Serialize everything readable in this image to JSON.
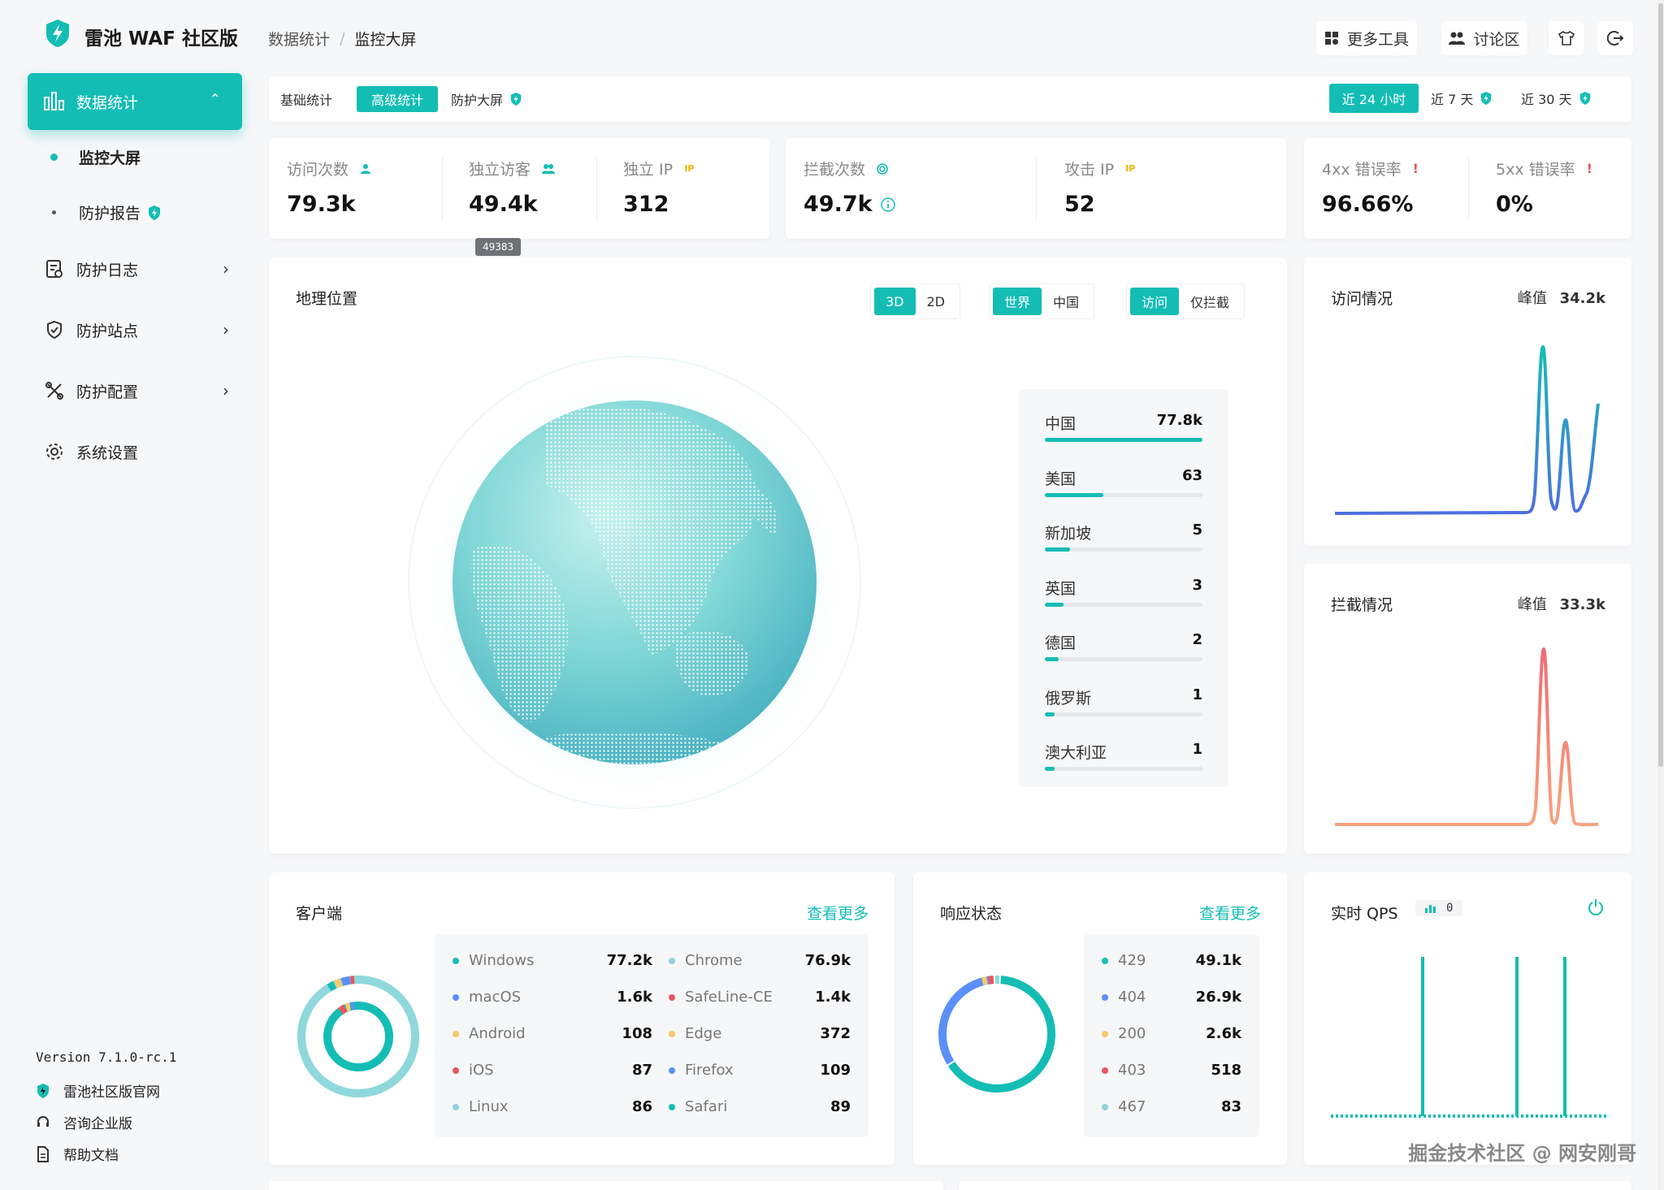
{
  "app": {
    "title": "雷池 WAF 社区版"
  },
  "breadcrumb": {
    "parent": "数据统计",
    "sep": "/",
    "current": "监控大屏"
  },
  "header": {
    "more_tools": "更多工具",
    "forum": "讨论区"
  },
  "sidebar": {
    "stats": "数据统计",
    "sub_monitor": "监控大屏",
    "sub_report": "防护报告",
    "items": [
      "防护日志",
      "防护站点",
      "防护配置",
      "系统设置"
    ],
    "version": "Version 7.1.0-rc.1",
    "footer": [
      "雷池社区版官网",
      "咨询企业版",
      "帮助文档"
    ]
  },
  "tabs": {
    "basic": "基础统计",
    "advanced": "高级统计",
    "screen": "防护大屏"
  },
  "ranges": {
    "r24h": "近 24 小时",
    "r7d": "近 7 天",
    "r30d": "近 30 天"
  },
  "stats": {
    "visits": {
      "label": "访问次数",
      "value": "79.3k"
    },
    "uv": {
      "label": "独立访客",
      "value": "49.4k",
      "tooltip": "49383"
    },
    "ip": {
      "label": "独立 IP",
      "value": "312"
    },
    "blocks": {
      "label": "拦截次数",
      "value": "49.7k"
    },
    "attack_ip": {
      "label": "攻击 IP",
      "value": "52"
    },
    "err4xx": {
      "label": "4xx 错误率",
      "value": "96.66%"
    },
    "err5xx": {
      "label": "5xx 错误率",
      "value": "0%"
    },
    "ip_badge": "IP"
  },
  "geo": {
    "title": "地理位置",
    "dim": [
      "3D",
      "2D"
    ],
    "scope": [
      "世界",
      "中国"
    ],
    "mode": [
      "访问",
      "仅拦截"
    ],
    "countries": [
      {
        "name": "中国",
        "value": "77.8k",
        "pct": 100
      },
      {
        "name": "美国",
        "value": "63",
        "pct": 37
      },
      {
        "name": "新加坡",
        "value": "5",
        "pct": 16
      },
      {
        "name": "英国",
        "value": "3",
        "pct": 12
      },
      {
        "name": "德国",
        "value": "2",
        "pct": 9
      },
      {
        "name": "俄罗斯",
        "value": "1",
        "pct": 6
      },
      {
        "name": "澳大利亚",
        "value": "1",
        "pct": 6
      }
    ]
  },
  "visits_card": {
    "title": "访问情况",
    "peak_label": "峰值",
    "peak": "34.2k"
  },
  "blocks_card": {
    "title": "拦截情况",
    "peak_label": "峰值",
    "peak": "33.3k"
  },
  "clients": {
    "title": "客户端",
    "more": "查看更多",
    "os": [
      {
        "name": "Windows",
        "value": "77.2k",
        "color": "#14bdb4"
      },
      {
        "name": "macOS",
        "value": "1.6k",
        "color": "#5b8ff9"
      },
      {
        "name": "Android",
        "value": "108",
        "color": "#f6c96a"
      },
      {
        "name": "iOS",
        "value": "87",
        "color": "#e8565f"
      },
      {
        "name": "Linux",
        "value": "86",
        "color": "#8fd3dc"
      }
    ],
    "browsers": [
      {
        "name": "Chrome",
        "value": "76.9k",
        "color": "#8fd3dc"
      },
      {
        "name": "SafeLine-CE",
        "value": "1.4k",
        "color": "#e8565f"
      },
      {
        "name": "Edge",
        "value": "372",
        "color": "#f6c96a"
      },
      {
        "name": "Firefox",
        "value": "109",
        "color": "#5b8ff9"
      },
      {
        "name": "Safari",
        "value": "89",
        "color": "#14bdb4"
      }
    ]
  },
  "status": {
    "title": "响应状态",
    "more": "查看更多",
    "codes": [
      {
        "name": "429",
        "value": "49.1k",
        "color": "#14bdb4"
      },
      {
        "name": "404",
        "value": "26.9k",
        "color": "#5b8ff9"
      },
      {
        "name": "200",
        "value": "2.6k",
        "color": "#f6c96a"
      },
      {
        "name": "403",
        "value": "518",
        "color": "#e8565f"
      },
      {
        "name": "467",
        "value": "83",
        "color": "#8fd3dc"
      }
    ]
  },
  "qps": {
    "title": "实时 QPS",
    "value": "0"
  },
  "watermark": "掘金技术社区 @ 网安刚哥",
  "colors": {
    "accent": "#14bdb4",
    "blue": "#4f6fe0",
    "red": "#ef6b73"
  }
}
